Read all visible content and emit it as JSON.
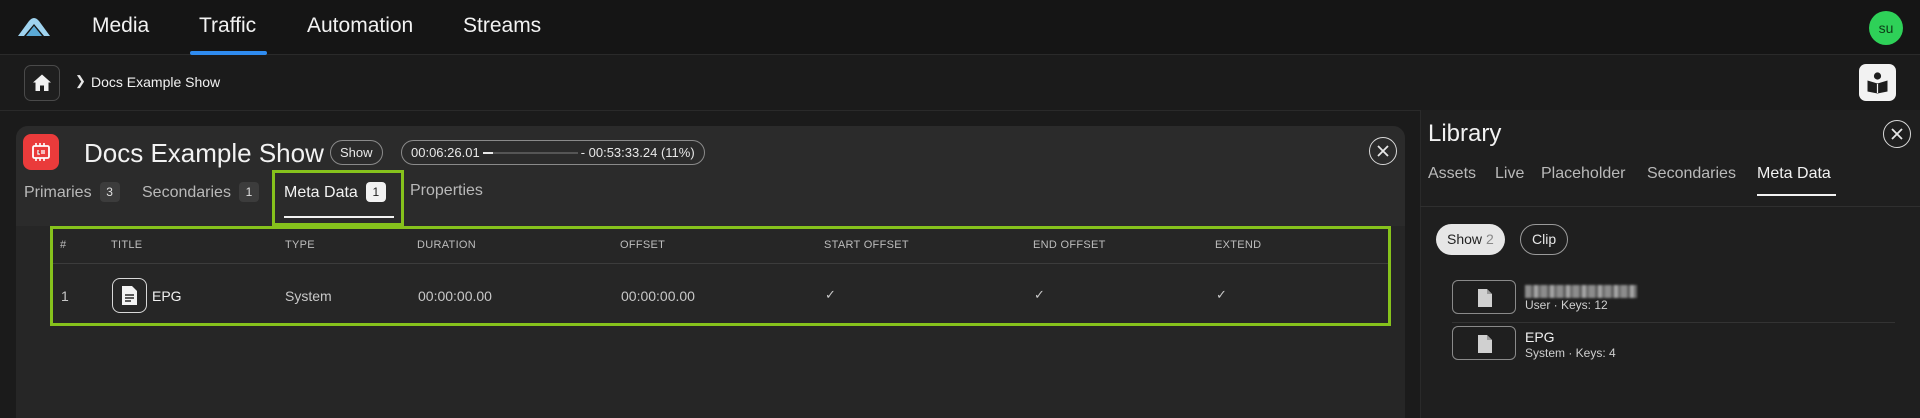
{
  "nav": {
    "items": [
      {
        "label": "Media"
      },
      {
        "label": "Traffic",
        "active": true
      },
      {
        "label": "Automation"
      },
      {
        "label": "Streams"
      }
    ],
    "avatar_initials": "su",
    "accent_color": "#2f8cf0",
    "avatar_color": "#2ed158"
  },
  "breadcrumb": {
    "home_icon": "home-icon",
    "current": "Docs Example Show",
    "help_icon": "book-reader-icon"
  },
  "panel": {
    "title": "Docs Example Show",
    "icon": "show-film-icon",
    "icon_color": "#ea3b3b",
    "type_pill": "Show",
    "progress": {
      "elapsed": "00:06:26.01",
      "remaining": "- 00:53:33.24",
      "percent_label": "(11%)",
      "fraction": 0.11
    },
    "tabs": [
      {
        "label": "Primaries",
        "count": "3"
      },
      {
        "label": "Secondaries",
        "count": "1"
      },
      {
        "label": "Meta Data",
        "count": "1",
        "active": true
      },
      {
        "label": "Properties",
        "count": ""
      }
    ],
    "highlight_color": "#86c21c",
    "table": {
      "columns": [
        "#",
        "TITLE",
        "TYPE",
        "DURATION",
        "OFFSET",
        "START OFFSET",
        "END OFFSET",
        "EXTEND"
      ],
      "rows": [
        {
          "index": "1",
          "title": "EPG",
          "icon": "document-icon",
          "type": "System",
          "duration": "00:00:00.00",
          "offset": "00:00:00.00",
          "start_offset": "✓",
          "end_offset": "✓",
          "extend": "✓"
        }
      ]
    }
  },
  "library": {
    "title": "Library",
    "tabs": [
      {
        "label": "Assets"
      },
      {
        "label": "Live"
      },
      {
        "label": "Placeholder"
      },
      {
        "label": "Secondaries"
      },
      {
        "label": "Meta Data",
        "active": true
      }
    ],
    "filters": [
      {
        "label": "Show",
        "count": "2",
        "selected": true
      },
      {
        "label": "Clip",
        "count": "",
        "selected": false
      }
    ],
    "items": [
      {
        "name": "",
        "name_redacted": true,
        "subtitle": "User · Keys: 12",
        "icon": "document-filled-icon"
      },
      {
        "name": "EPG",
        "subtitle": "System · Keys: 4",
        "icon": "document-filled-icon"
      }
    ]
  }
}
